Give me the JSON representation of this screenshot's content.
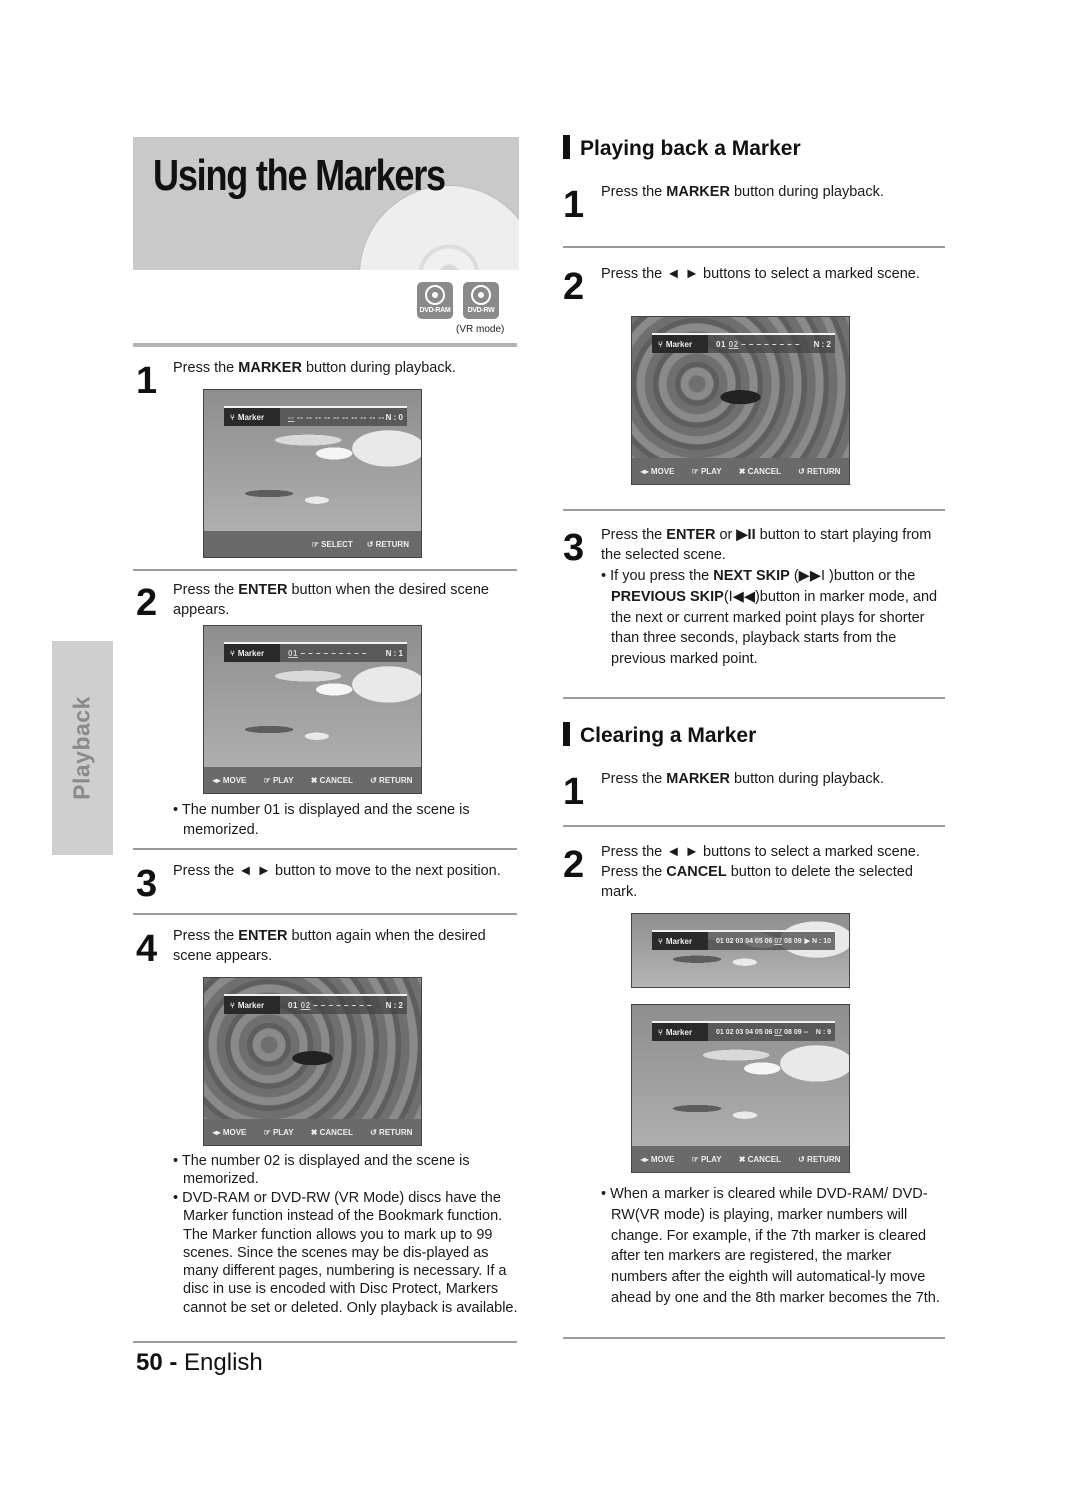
{
  "page": {
    "title": "Using the Markers",
    "side_tab": "Playback",
    "footer": {
      "page_number": "50",
      "separator": " - ",
      "language": "English"
    }
  },
  "badges": [
    {
      "icon": "disc-icon",
      "label": "DVD-RAM"
    },
    {
      "icon": "disc-icon",
      "label": "DVD-RW"
    }
  ],
  "badge_note": "(VR mode)",
  "left": {
    "steps": [
      {
        "num": "1",
        "pre": "Press the ",
        "bold": "MARKER",
        "post": " button during playback."
      },
      {
        "num": "2",
        "pre": "Press the ",
        "bold": "ENTER",
        "post": " button when the desired scene appears."
      },
      {
        "num": "3",
        "pre": "Press the ◄ ► button to move to the next position.",
        "bold": "",
        "post": ""
      },
      {
        "num": "4",
        "pre": "Press the ",
        "bold": "ENTER",
        "post": " button again when the desired scene appears."
      }
    ],
    "bullets_step2": [
      "The number 01 is displayed and the scene is memorized."
    ],
    "bullets_step4": [
      "The number 02 is displayed and the scene is memorized.",
      "DVD-RAM or DVD-RW (VR Mode) discs have the Marker function instead of the Bookmark function. The Marker function allows you to mark up to 99 scenes. Since the scenes may be dis-played as many different pages, numbering is necessary. If a disc in use is encoded with Disc Protect, Markers cannot be set or deleted. Only playback is available."
    ]
  },
  "screens": {
    "s1": {
      "label": "Marker",
      "marks_before": "",
      "current": "--",
      "marks_after": " -- -- -- -- -- -- -- -- -- --",
      "count": "N : 0",
      "buttons": [
        "SELECT",
        "RETURN"
      ]
    },
    "s2": {
      "label": "Marker",
      "marks_before": "",
      "current": "01",
      "marks_after": " – – – – – – – – –",
      "count": "N : 1",
      "buttons": [
        "MOVE",
        "PLAY",
        "CANCEL",
        "RETURN"
      ]
    },
    "s3": {
      "label": "Marker",
      "marks_before": "01 ",
      "current": "02",
      "marks_after": " – – – – – – – –",
      "count": "N : 2",
      "buttons": [
        "MOVE",
        "PLAY",
        "CANCEL",
        "RETURN"
      ]
    },
    "s4": {
      "label": "Marker",
      "marks_before": "01 ",
      "current": "02",
      "marks_after": " – – – – – – – –",
      "count": "N : 2",
      "buttons": [
        "MOVE",
        "PLAY",
        "CANCEL",
        "RETURN"
      ]
    },
    "s5": {
      "label": "Marker",
      "marks_before": "01 02 03 04 05 06 ",
      "current": "07",
      "marks_after": " 08 09 10",
      "count": "▶ N : 10",
      "buttons": []
    },
    "s6": {
      "label": "Marker",
      "marks_before": "01 02 03 04 05 06 ",
      "current": "07",
      "marks_after": " 08 09 --",
      "count": "N : 9",
      "buttons": [
        "MOVE",
        "PLAY",
        "CANCEL",
        "RETURN"
      ]
    }
  },
  "right": {
    "playback": {
      "heading": "Playing back a Marker",
      "step1": {
        "num": "1",
        "pre": "Press the ",
        "bold": "MARKER",
        "post": " button during playback."
      },
      "step2": {
        "num": "2",
        "text": "Press the ◄ ► buttons to select a marked scene."
      },
      "step3": {
        "num": "3",
        "pre": "Press the ",
        "bold": "ENTER",
        "mid": " or ",
        "bold2": "▶II",
        "post": " button to start playing from the selected scene."
      },
      "step3_bullet": {
        "pre": "If you press the ",
        "bold1": "NEXT SKIP",
        "mid1": " (▶▶I )button or the ",
        "bold2": "PREVIOUS SKIP",
        "mid2": "(I◀◀)button in marker mode, and the next or current marked point plays for shorter than three seconds, playback starts from the previous marked point."
      }
    },
    "clearing": {
      "heading": "Clearing a Marker",
      "step1": {
        "num": "1",
        "pre": "Press the ",
        "bold": "MARKER",
        "post": " button during playback."
      },
      "step2": {
        "num": "2",
        "line1": "Press the ◄ ► buttons to select a marked scene.",
        "pre": "Press the ",
        "bold": "CANCEL",
        "post": " button to delete the selected mark."
      },
      "bullet": "When a marker is cleared while DVD-RAM/ DVD-RW(VR mode) is playing, marker numbers will change. For example, if the 7th marker is cleared after ten markers are registered, the marker numbers after the eighth will automatical-ly move ahead by one and the 8th marker becomes the 7th."
    }
  },
  "icons": {
    "marker": "⑂",
    "move": "◂▸",
    "play": "☞",
    "cancel": "✖",
    "return": "↺",
    "select": "☞"
  }
}
